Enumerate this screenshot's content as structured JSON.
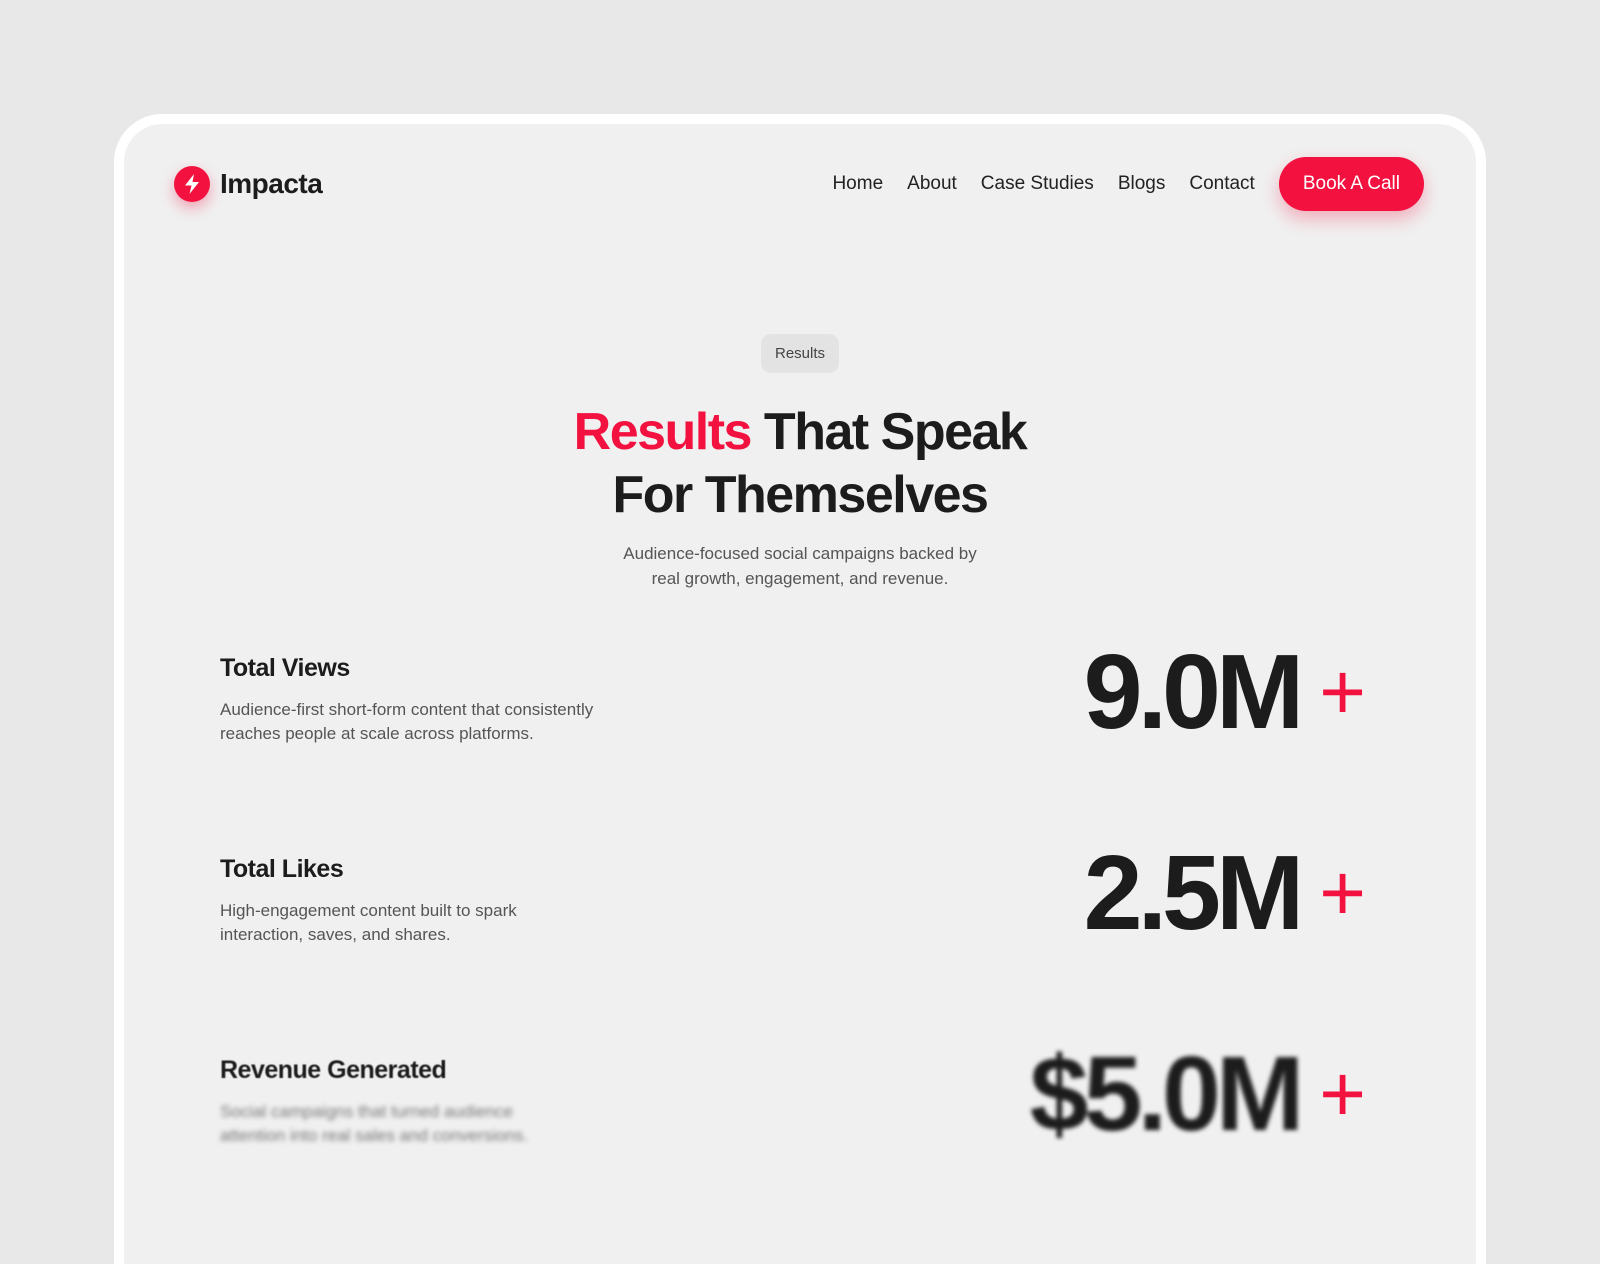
{
  "brand": {
    "name": "Impacta",
    "logo_icon": "lightning-bolt-icon",
    "accent_color": "#f2113f"
  },
  "nav": {
    "links": [
      "Home",
      "About",
      "Case Studies",
      "Blogs",
      "Contact"
    ],
    "cta_label": "Book A Call"
  },
  "hero": {
    "badge": "Results",
    "headline_accent": "Results",
    "headline_rest_line1": " That Speak",
    "headline_line2": "For Themselves",
    "subtext": "Audience-focused social campaigns backed by real growth, engagement, and revenue."
  },
  "stats": [
    {
      "title": "Total Views",
      "description": "Audience-first short-form content that consistently reaches people at scale across platforms.",
      "value": "9.0M",
      "suffix": "+"
    },
    {
      "title": "Total Likes",
      "description": "High-engagement content built to spark interaction, saves, and shares.",
      "value": "2.5M",
      "suffix": "+"
    },
    {
      "title": "Revenue Generated",
      "description": "Social campaigns that turned audience attention into real sales and conversions.",
      "value": "$5.0M",
      "suffix": "+"
    }
  ]
}
